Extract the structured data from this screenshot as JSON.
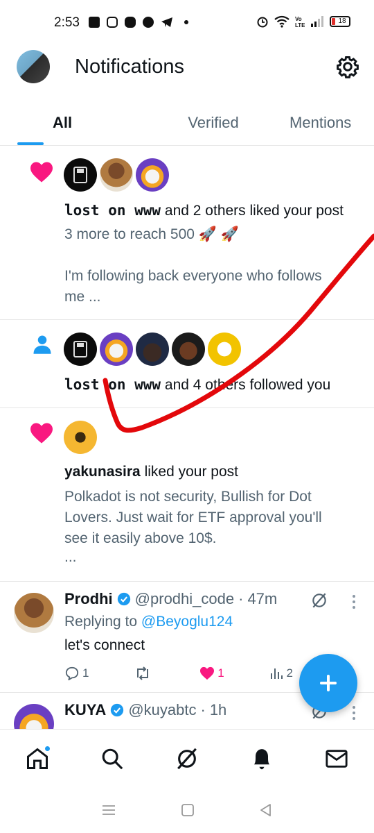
{
  "status_bar": {
    "time": "2:53",
    "battery": "18"
  },
  "header": {
    "title": "Notifications"
  },
  "tabs": [
    {
      "label": "All",
      "active": true
    },
    {
      "label": "Verified",
      "active": false
    },
    {
      "label": "Mentions",
      "active": false
    }
  ],
  "notifications": [
    {
      "type": "like",
      "actor": "lost on www",
      "action": "and 2 others liked your post",
      "post_line1": "3 more to reach 500 🚀 🚀",
      "post_line2": "I'm following back everyone who follows",
      "post_line3": "me ..."
    },
    {
      "type": "follow",
      "actor": "lost on www",
      "action": "and 4 others followed you"
    },
    {
      "type": "like",
      "actor": "yakunasira",
      "action": "liked your post",
      "post_line1": "Polkadot is not security, Bullish for Dot",
      "post_line2": "Lovers. Just wait for ETF approval you'll",
      "post_line3": "see it easily above 10$.",
      "post_line4": "..."
    }
  ],
  "tweets": [
    {
      "name": "Prodhi",
      "handle": "@prodhi_code",
      "time": "47m",
      "replying_prefix": "Replying to",
      "replying_to": "@Beyoglu124",
      "body": "let's connect",
      "replies": "1",
      "reposts": "",
      "likes": "1",
      "views": "2"
    },
    {
      "name": "KUYA",
      "handle": "@kuyabtc",
      "time": "1h"
    }
  ],
  "icons": {
    "like": "heart-icon",
    "follow": "person-icon",
    "settings": "gear-icon",
    "compose": "plus-icon",
    "nav": [
      "home-icon",
      "search-icon",
      "grok-icon",
      "bell-icon",
      "mail-icon"
    ]
  },
  "colors": {
    "accent": "#1d9bf0",
    "like": "#f91880",
    "annotation": "#e3080b"
  }
}
